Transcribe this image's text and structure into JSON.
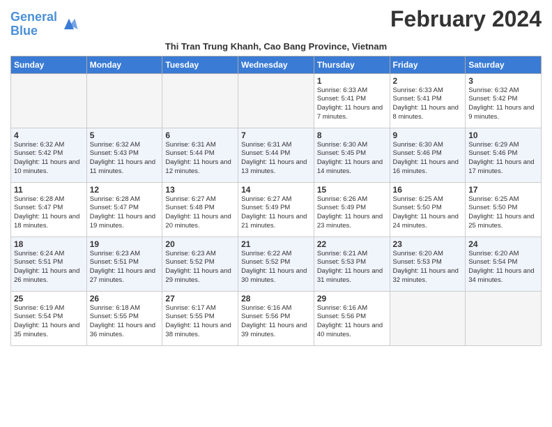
{
  "header": {
    "logo_line1": "General",
    "logo_line2": "Blue",
    "title": "February 2024",
    "subtitle": "Thi Tran Trung Khanh, Cao Bang Province, Vietnam"
  },
  "days_of_week": [
    "Sunday",
    "Monday",
    "Tuesday",
    "Wednesday",
    "Thursday",
    "Friday",
    "Saturday"
  ],
  "weeks": [
    [
      {
        "day": "",
        "info": ""
      },
      {
        "day": "",
        "info": ""
      },
      {
        "day": "",
        "info": ""
      },
      {
        "day": "",
        "info": ""
      },
      {
        "day": "1",
        "info": "Sunrise: 6:33 AM\nSunset: 5:41 PM\nDaylight: 11 hours and 7 minutes."
      },
      {
        "day": "2",
        "info": "Sunrise: 6:33 AM\nSunset: 5:41 PM\nDaylight: 11 hours and 8 minutes."
      },
      {
        "day": "3",
        "info": "Sunrise: 6:32 AM\nSunset: 5:42 PM\nDaylight: 11 hours and 9 minutes."
      }
    ],
    [
      {
        "day": "4",
        "info": "Sunrise: 6:32 AM\nSunset: 5:42 PM\nDaylight: 11 hours and 10 minutes."
      },
      {
        "day": "5",
        "info": "Sunrise: 6:32 AM\nSunset: 5:43 PM\nDaylight: 11 hours and 11 minutes."
      },
      {
        "day": "6",
        "info": "Sunrise: 6:31 AM\nSunset: 5:44 PM\nDaylight: 11 hours and 12 minutes."
      },
      {
        "day": "7",
        "info": "Sunrise: 6:31 AM\nSunset: 5:44 PM\nDaylight: 11 hours and 13 minutes."
      },
      {
        "day": "8",
        "info": "Sunrise: 6:30 AM\nSunset: 5:45 PM\nDaylight: 11 hours and 14 minutes."
      },
      {
        "day": "9",
        "info": "Sunrise: 6:30 AM\nSunset: 5:46 PM\nDaylight: 11 hours and 16 minutes."
      },
      {
        "day": "10",
        "info": "Sunrise: 6:29 AM\nSunset: 5:46 PM\nDaylight: 11 hours and 17 minutes."
      }
    ],
    [
      {
        "day": "11",
        "info": "Sunrise: 6:28 AM\nSunset: 5:47 PM\nDaylight: 11 hours and 18 minutes."
      },
      {
        "day": "12",
        "info": "Sunrise: 6:28 AM\nSunset: 5:47 PM\nDaylight: 11 hours and 19 minutes."
      },
      {
        "day": "13",
        "info": "Sunrise: 6:27 AM\nSunset: 5:48 PM\nDaylight: 11 hours and 20 minutes."
      },
      {
        "day": "14",
        "info": "Sunrise: 6:27 AM\nSunset: 5:49 PM\nDaylight: 11 hours and 21 minutes."
      },
      {
        "day": "15",
        "info": "Sunrise: 6:26 AM\nSunset: 5:49 PM\nDaylight: 11 hours and 23 minutes."
      },
      {
        "day": "16",
        "info": "Sunrise: 6:25 AM\nSunset: 5:50 PM\nDaylight: 11 hours and 24 minutes."
      },
      {
        "day": "17",
        "info": "Sunrise: 6:25 AM\nSunset: 5:50 PM\nDaylight: 11 hours and 25 minutes."
      }
    ],
    [
      {
        "day": "18",
        "info": "Sunrise: 6:24 AM\nSunset: 5:51 PM\nDaylight: 11 hours and 26 minutes."
      },
      {
        "day": "19",
        "info": "Sunrise: 6:23 AM\nSunset: 5:51 PM\nDaylight: 11 hours and 27 minutes."
      },
      {
        "day": "20",
        "info": "Sunrise: 6:23 AM\nSunset: 5:52 PM\nDaylight: 11 hours and 29 minutes."
      },
      {
        "day": "21",
        "info": "Sunrise: 6:22 AM\nSunset: 5:52 PM\nDaylight: 11 hours and 30 minutes."
      },
      {
        "day": "22",
        "info": "Sunrise: 6:21 AM\nSunset: 5:53 PM\nDaylight: 11 hours and 31 minutes."
      },
      {
        "day": "23",
        "info": "Sunrise: 6:20 AM\nSunset: 5:53 PM\nDaylight: 11 hours and 32 minutes."
      },
      {
        "day": "24",
        "info": "Sunrise: 6:20 AM\nSunset: 5:54 PM\nDaylight: 11 hours and 34 minutes."
      }
    ],
    [
      {
        "day": "25",
        "info": "Sunrise: 6:19 AM\nSunset: 5:54 PM\nDaylight: 11 hours and 35 minutes."
      },
      {
        "day": "26",
        "info": "Sunrise: 6:18 AM\nSunset: 5:55 PM\nDaylight: 11 hours and 36 minutes."
      },
      {
        "day": "27",
        "info": "Sunrise: 6:17 AM\nSunset: 5:55 PM\nDaylight: 11 hours and 38 minutes."
      },
      {
        "day": "28",
        "info": "Sunrise: 6:16 AM\nSunset: 5:56 PM\nDaylight: 11 hours and 39 minutes."
      },
      {
        "day": "29",
        "info": "Sunrise: 6:16 AM\nSunset: 5:56 PM\nDaylight: 11 hours and 40 minutes."
      },
      {
        "day": "",
        "info": ""
      },
      {
        "day": "",
        "info": ""
      }
    ]
  ]
}
